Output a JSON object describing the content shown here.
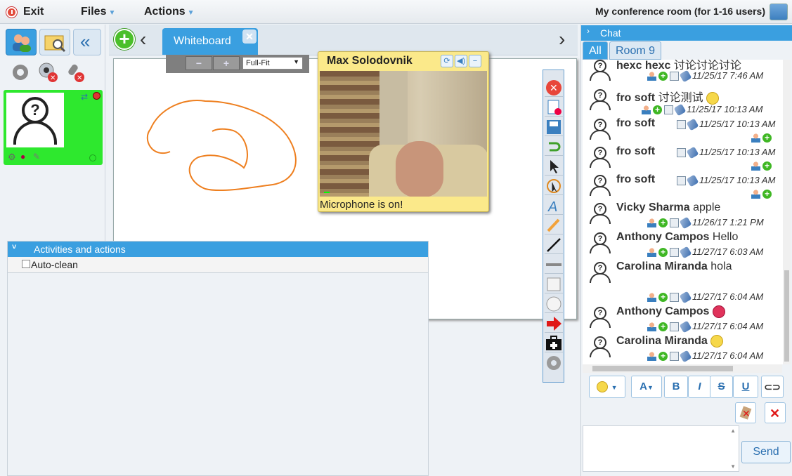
{
  "menu": {
    "exit": "Exit",
    "files": "Files",
    "actions": "Actions",
    "room_title": "My conference room (for 1-16 users)"
  },
  "whiteboard": {
    "tab": "Whiteboard",
    "zoom_select": "Full-Fit",
    "zoom_minus": "−",
    "zoom_plus": "+"
  },
  "video": {
    "name": "Max Solodovnik",
    "status": "Microphone is on!"
  },
  "activities": {
    "title": "Activities and actions",
    "auto_clean": "Auto-clean"
  },
  "chat": {
    "title": "Chat",
    "tabs": [
      "All",
      "Room 9"
    ],
    "messages": [
      {
        "name": "hexc hexc",
        "text": "讨论讨论讨论",
        "time": "11/25/17 7:46 AM"
      },
      {
        "name": "fro soft",
        "text": "讨论测试",
        "time": "11/25/17 10:13 AM"
      },
      {
        "name": "fro soft",
        "text": "",
        "time": "11/25/17 10:13 AM"
      },
      {
        "name": "fro soft",
        "text": "",
        "time": "11/25/17 10:13 AM"
      },
      {
        "name": "fro soft",
        "text": "",
        "time": "11/25/17 10:13 AM"
      },
      {
        "name": "Vicky Sharma",
        "text": "apple",
        "time": "11/26/17 1:21 PM"
      },
      {
        "name": "Anthony Campos",
        "text": "Hello",
        "time": "11/27/17 6:03 AM"
      },
      {
        "name": "Carolina Miranda",
        "text": "hola",
        "time": "11/27/17 6:04 AM"
      },
      {
        "name": "Anthony Campos",
        "text": "",
        "time": "11/27/17 6:04 AM"
      },
      {
        "name": "Carolina Miranda",
        "text": "",
        "time": "11/27/17 6:04 AM"
      }
    ],
    "format": {
      "bold": "B",
      "italic": "I",
      "strike": "S",
      "underline": "U",
      "font": "A"
    },
    "send": "Send"
  }
}
